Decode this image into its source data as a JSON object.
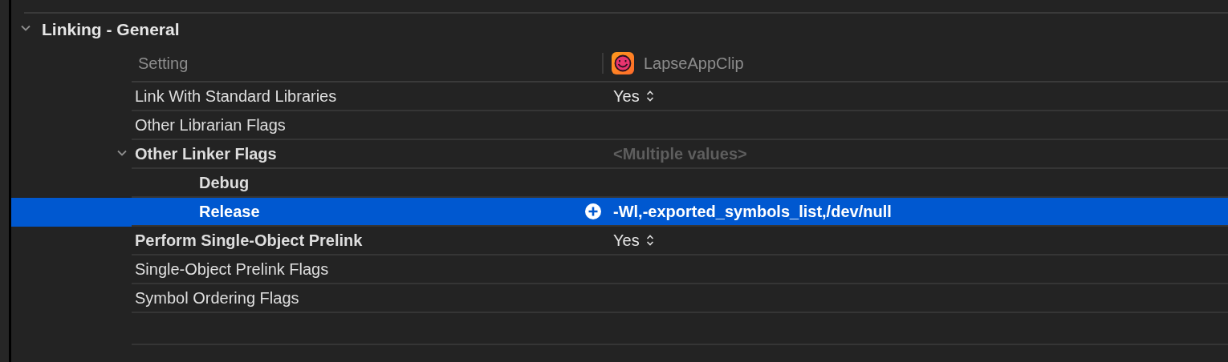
{
  "section": {
    "title": "Linking - General",
    "expanded": true
  },
  "header": {
    "setting": "Setting",
    "target": "LapseAppClip"
  },
  "settings": [
    {
      "name": "Link With Standard Libraries",
      "bold": false,
      "value": "Yes",
      "kind": "popup",
      "selected": false
    },
    {
      "name": "Other Librarian Flags",
      "bold": false,
      "selected": false
    },
    {
      "name": "Other Linker Flags",
      "bold": true,
      "value": "<Multiple values>",
      "kind": "multiple",
      "selected": false,
      "expanded": true,
      "children": [
        {
          "name": "Debug",
          "bold": true,
          "selected": false
        },
        {
          "name": "Release",
          "bold": true,
          "value": "-Wl,-exported_symbols_list,/dev/null",
          "kind": "text",
          "selected": true
        }
      ]
    },
    {
      "name": "Perform Single-Object Prelink",
      "bold": true,
      "value": "Yes",
      "kind": "popup",
      "selected": false
    },
    {
      "name": "Single-Object Prelink Flags",
      "bold": false,
      "selected": false
    },
    {
      "name": "Symbol Ordering Flags",
      "bold": false,
      "selected": false
    }
  ]
}
